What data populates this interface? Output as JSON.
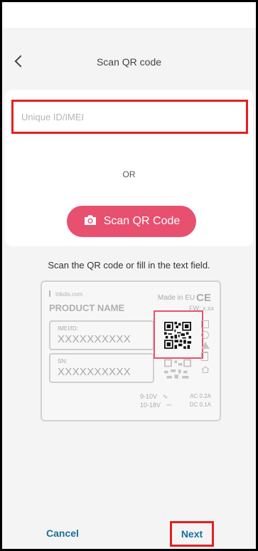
{
  "header": {
    "title": "Scan QR code"
  },
  "form": {
    "id_input": {
      "value": "",
      "placeholder": "Unique ID/IMEI"
    },
    "or_label": "OR",
    "scan_button_label": "Scan QR Code"
  },
  "hint": "Scan the QR code or fill in the text field.",
  "device_label": {
    "brand": "trikdis.com",
    "made_in": "Made in EU",
    "ce_mark": "CE",
    "product_name": "PRODUCT NAME",
    "fw": "FW: x.xx",
    "imei_label": "IMEI/ID:",
    "imei_value": "XXXXXXXXXX",
    "sn_label": "SN:",
    "sn_value": "XXXXXXXXXX",
    "voltage_1": "9-10V",
    "voltage_2": "10-18V",
    "current_1": "AC 0.2A",
    "current_2": "DC 0.1A"
  },
  "footer": {
    "cancel_label": "Cancel",
    "next_label": "Next"
  },
  "colors": {
    "accent_pink": "#e8506f",
    "link_blue": "#1a6f9c",
    "highlight_red": "#e32020"
  },
  "icons": {
    "back": "chevron-left-icon",
    "camera": "camera-icon"
  }
}
